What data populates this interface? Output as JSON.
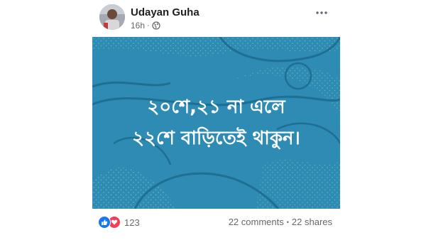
{
  "post": {
    "author": "Udayan Guha",
    "time": "16h",
    "separator": "·",
    "privacy_icon": "globe-icon",
    "more_icon": "ellipsis-icon",
    "image_text": {
      "line1": "২০শে,২১ না এলে",
      "line2": "২২শে বাড়িতেই থাকুন।"
    },
    "image_bg_color": "#2e8bb3",
    "reactions": {
      "icons": [
        "like-icon",
        "love-icon"
      ],
      "count": "123",
      "comments": "22 comments",
      "dot": "•",
      "shares": "22 shares"
    }
  }
}
